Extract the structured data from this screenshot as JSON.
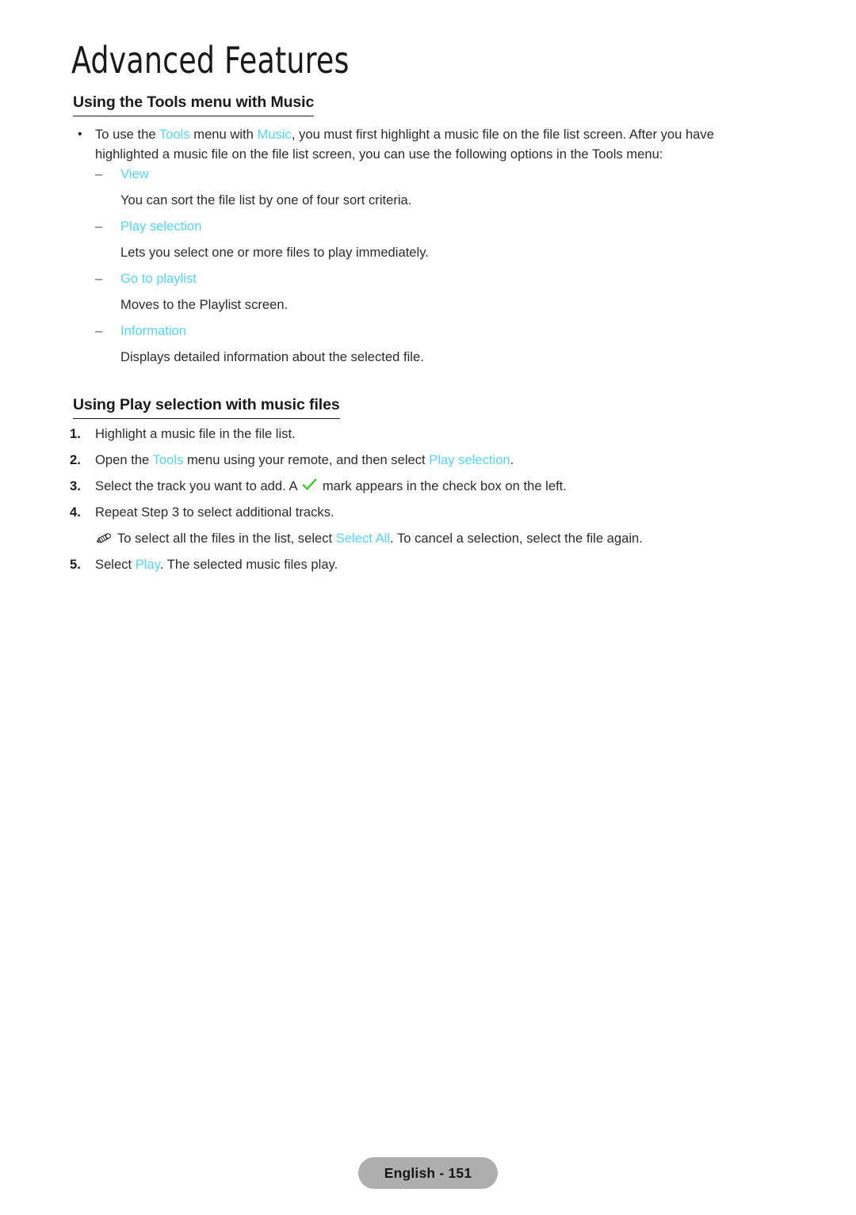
{
  "page": {
    "chapter_title": "Advanced Features",
    "footer_label": "English - 151",
    "accent_color": "#4fd6f5",
    "check_color": "#3ecc2e",
    "footer_badge_color": "#aeaeae"
  },
  "section_tools": {
    "heading": "Using the Tools menu with Music",
    "intro": {
      "before_tools": "To use the ",
      "tools": "Tools",
      "between": " menu with ",
      "music": "Music",
      "after": ", you must first highlight a music file on the file list screen. After you have highlighted a music file on the file list screen, you can use the following options in the Tools menu:"
    },
    "options": [
      {
        "label": "View",
        "description": "You can sort the file list by one of four sort criteria."
      },
      {
        "label": "Play selection",
        "description": "Lets you select one or more files to play immediately."
      },
      {
        "label": "Go to playlist",
        "description": "Moves to the Playlist screen."
      },
      {
        "label": "Information",
        "description": "Displays detailed information about the selected file."
      }
    ]
  },
  "section_playselection": {
    "heading": "Using Play selection with music files",
    "steps": [
      {
        "number": "1.",
        "parts": [
          {
            "text": "Highlight a music file in the file list.",
            "accent": false
          }
        ]
      },
      {
        "number": "2.",
        "parts": [
          {
            "text": "Open the ",
            "accent": false
          },
          {
            "text": "Tools",
            "accent": true
          },
          {
            "text": " menu using your remote, and then select ",
            "accent": false
          },
          {
            "text": "Play selection",
            "accent": true
          },
          {
            "text": ".",
            "accent": false
          }
        ]
      },
      {
        "number": "3.",
        "parts": [
          {
            "text": "Select the track you want to add. A ",
            "accent": false
          },
          {
            "icon": "check-icon"
          },
          {
            "text": " mark appears in the check box on the left.",
            "accent": false
          }
        ]
      },
      {
        "number": "4.",
        "parts": [
          {
            "text": "Repeat Step 3 to select additional tracks.",
            "accent": false
          }
        ]
      },
      {
        "number": "5.",
        "parts": [
          {
            "text": "Select ",
            "accent": false
          },
          {
            "text": "Play",
            "accent": true
          },
          {
            "text": ". The selected music files play.",
            "accent": false
          }
        ]
      }
    ],
    "note": {
      "icon": "pencil-icon",
      "before": "To select all the files in the list, select ",
      "accent": "Select All",
      "after": ". To cancel a selection, select the file again."
    }
  }
}
